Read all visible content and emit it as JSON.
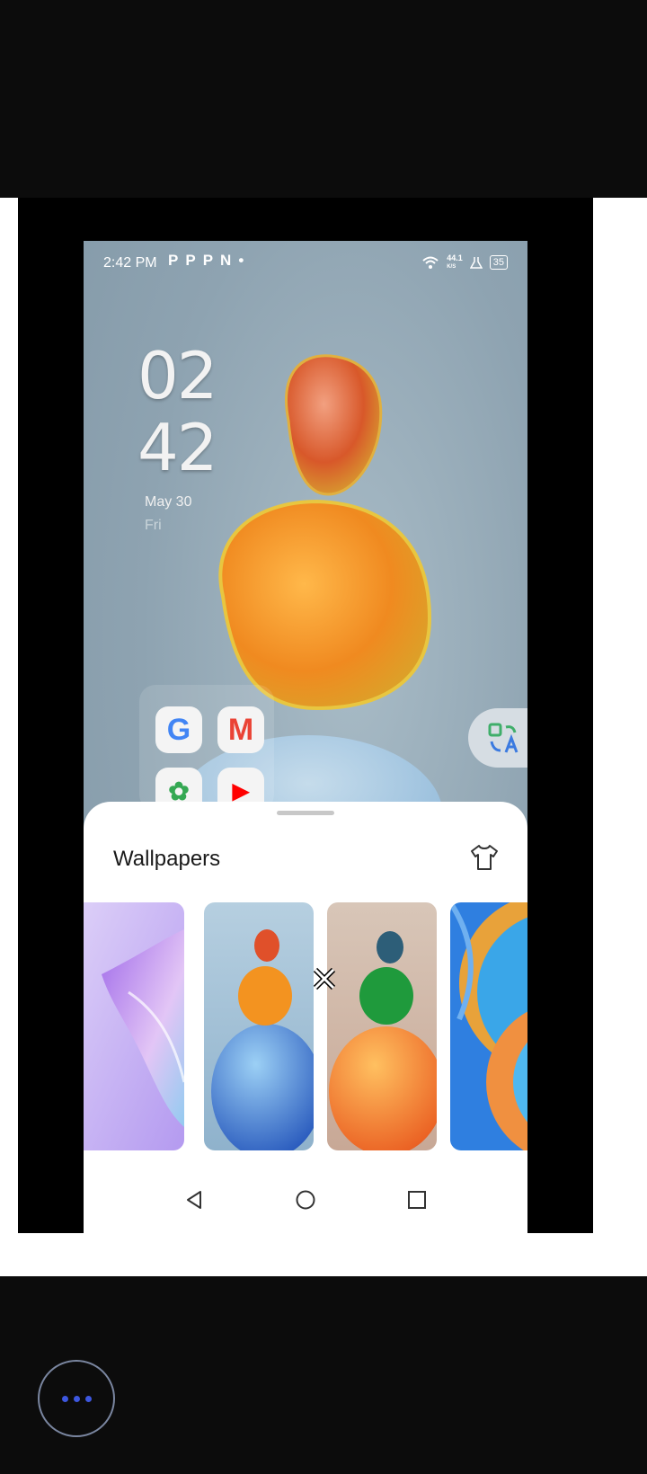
{
  "status_bar": {
    "time": "2:42 PM",
    "notification_icons": [
      "P",
      "P",
      "P",
      "N",
      "•"
    ],
    "net_speed_value": "44.1",
    "net_speed_unit": "K/S",
    "battery": "35"
  },
  "clock": {
    "hour": "02",
    "minute": "42",
    "date": "May 30",
    "day": "Fri"
  },
  "apps": [
    {
      "name": "Google",
      "glyph": "G",
      "color": "#4285f4"
    },
    {
      "name": "Gmail",
      "glyph": "M",
      "color": "#ea4335"
    },
    {
      "name": "Google Photos",
      "glyph": "✿",
      "color": "#34a853"
    },
    {
      "name": "YouTube",
      "glyph": "▶",
      "color": "#ff0000"
    }
  ],
  "sheet": {
    "title": "Wallpapers",
    "theme_icon": "t-shirt-icon"
  },
  "wallpapers": [
    {
      "name": "purple-swirl",
      "colors": [
        "#d8c8f5",
        "#b79af0"
      ]
    },
    {
      "name": "pebbles-blue",
      "colors": [
        "#b9d0df",
        "#2f6fd0"
      ]
    },
    {
      "name": "pebbles-green-orange",
      "colors": [
        "#d9c1b3",
        "#f07820"
      ]
    },
    {
      "name": "blue-orange-waves",
      "colors": [
        "#2f7fe0",
        "#f0a040"
      ]
    }
  ],
  "nav": {
    "back_icon": "back-triangle-icon",
    "home_icon": "home-circle-icon",
    "recents_icon": "recents-square-icon"
  },
  "fab_icon": "more-dots-icon",
  "colors": {
    "accent": "#3d57e0",
    "sheet_bg": "#ffffff",
    "outer_bg": "#0c0c0c"
  }
}
